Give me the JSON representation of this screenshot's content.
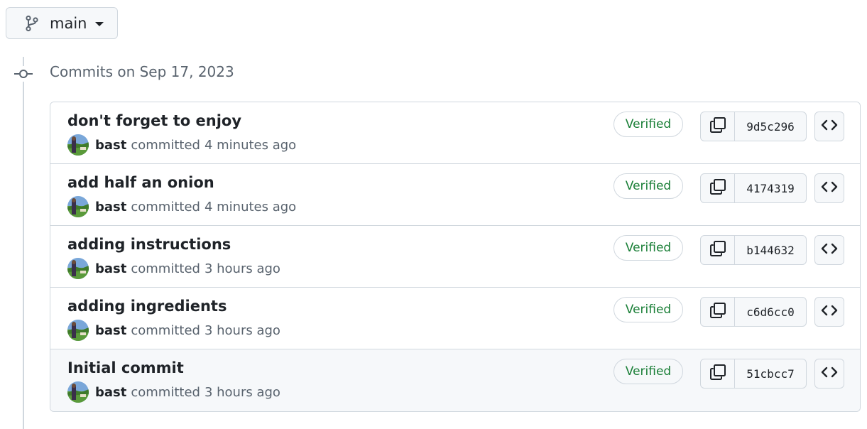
{
  "branch": {
    "name": "main",
    "icon": "git-branch-icon"
  },
  "date_heading": "Commits on Sep 17, 2023",
  "colors": {
    "verified": "#1a7f37",
    "border": "#d0d7de",
    "muted": "#59636e"
  },
  "commits": [
    {
      "title": "don't forget to enjoy",
      "author": "bast",
      "verb": "committed",
      "time": "4 minutes ago",
      "verified": "Verified",
      "sha": "9d5c296"
    },
    {
      "title": "add half an onion",
      "author": "bast",
      "verb": "committed",
      "time": "4 minutes ago",
      "verified": "Verified",
      "sha": "4174319"
    },
    {
      "title": "adding instructions",
      "author": "bast",
      "verb": "committed",
      "time": "3 hours ago",
      "verified": "Verified",
      "sha": "b144632"
    },
    {
      "title": "adding ingredients",
      "author": "bast",
      "verb": "committed",
      "time": "3 hours ago",
      "verified": "Verified",
      "sha": "c6d6cc0"
    },
    {
      "title": "Initial commit",
      "author": "bast",
      "verb": "committed",
      "time": "3 hours ago",
      "verified": "Verified",
      "sha": "51cbcc7"
    }
  ]
}
